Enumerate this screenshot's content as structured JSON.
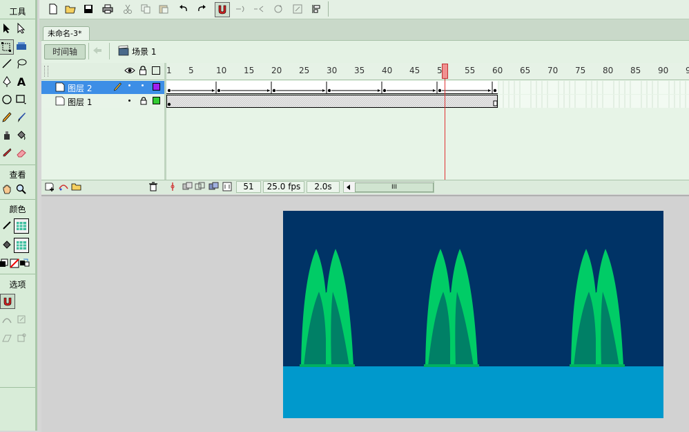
{
  "tools_panel": {
    "title": "工具",
    "view_label": "查看",
    "color_label": "颜色",
    "options_label": "选项"
  },
  "document_tab": {
    "title": "未命名-3*"
  },
  "edit_bar": {
    "timeline_button": "时间轴",
    "scene_label": "场景 1"
  },
  "timeline": {
    "ruler_ticks": [
      "1",
      "5",
      "10",
      "15",
      "20",
      "25",
      "30",
      "35",
      "40",
      "45",
      "50",
      "55",
      "60",
      "65",
      "70",
      "75",
      "80",
      "85",
      "90",
      "9"
    ],
    "playhead_frame": 51,
    "layers": [
      {
        "name": "图层 2",
        "selected": true,
        "color": "#a020f0"
      },
      {
        "name": "图层 1",
        "selected": false,
        "color": "#33cc33"
      }
    ],
    "current_frame": "51",
    "frame_rate": "25.0 fps",
    "elapsed_time": "2.0s"
  },
  "colors": {
    "sky": "#003366",
    "water": "#0099cc",
    "fountain_light": "#00cc66",
    "fountain_dark": "#008066",
    "panel_bg": "#d8ecd8"
  }
}
